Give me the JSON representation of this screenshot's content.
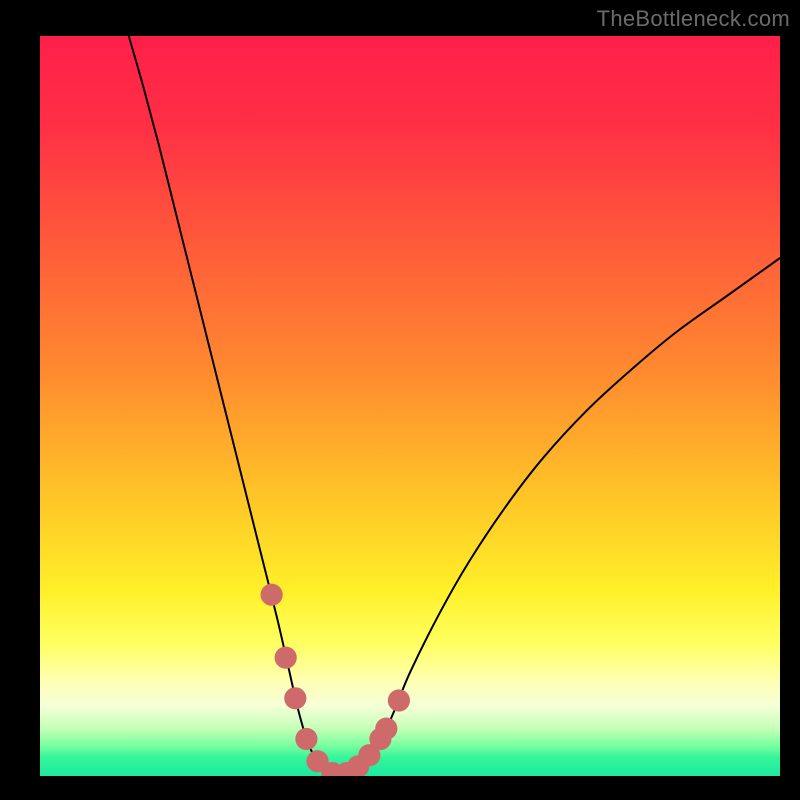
{
  "watermark": "TheBottleneck.com",
  "colors": {
    "curve": "#000000",
    "marker": "#cf6a6a",
    "gradient_stops": [
      {
        "offset": 0.0,
        "color": "#ff1f4a"
      },
      {
        "offset": 0.12,
        "color": "#ff2f45"
      },
      {
        "offset": 0.28,
        "color": "#ff5a3a"
      },
      {
        "offset": 0.46,
        "color": "#ff8c2f"
      },
      {
        "offset": 0.62,
        "color": "#ffc427"
      },
      {
        "offset": 0.75,
        "color": "#fff029"
      },
      {
        "offset": 0.82,
        "color": "#ffff60"
      },
      {
        "offset": 0.87,
        "color": "#ffffb0"
      },
      {
        "offset": 0.905,
        "color": "#f6ffd8"
      },
      {
        "offset": 0.935,
        "color": "#c6ffb8"
      },
      {
        "offset": 0.958,
        "color": "#7cffa0"
      },
      {
        "offset": 0.975,
        "color": "#36f59a"
      },
      {
        "offset": 1.0,
        "color": "#1de9a0"
      }
    ]
  },
  "chart_data": {
    "type": "line",
    "title": "",
    "xlabel": "",
    "ylabel": "",
    "xlim": [
      0,
      100
    ],
    "ylim": [
      0,
      100
    ],
    "series": [
      {
        "name": "bottleneck-curve",
        "x": [
          12,
          14,
          16,
          18,
          20,
          22,
          24,
          26,
          28,
          30,
          32,
          33.5,
          34.8,
          36,
          37.2,
          38.5,
          40,
          41.5,
          43,
          44.5,
          46,
          48,
          50,
          54,
          58,
          63,
          68,
          74,
          80,
          86,
          93,
          100
        ],
        "y": [
          100,
          93,
          85.5,
          77.5,
          69.5,
          61.5,
          53.5,
          45.5,
          37.5,
          29.5,
          21.5,
          15,
          9.3,
          5.1,
          2.4,
          0.9,
          0.2,
          0.2,
          0.9,
          2.3,
          4.6,
          9.1,
          14,
          22,
          29,
          36.5,
          43,
          49.5,
          55,
          60,
          65,
          70
        ]
      }
    ],
    "markers": {
      "name": "highlight-points",
      "x": [
        31.3,
        33.2,
        34.5,
        36.0,
        37.5,
        39.5,
        41.5,
        43.0,
        44.5,
        46.0,
        46.8,
        48.5
      ],
      "y": [
        24.5,
        16.0,
        10.5,
        5.0,
        2.0,
        0.4,
        0.4,
        1.3,
        2.8,
        5.0,
        6.4,
        10.2
      ],
      "radius": 1.5
    }
  }
}
